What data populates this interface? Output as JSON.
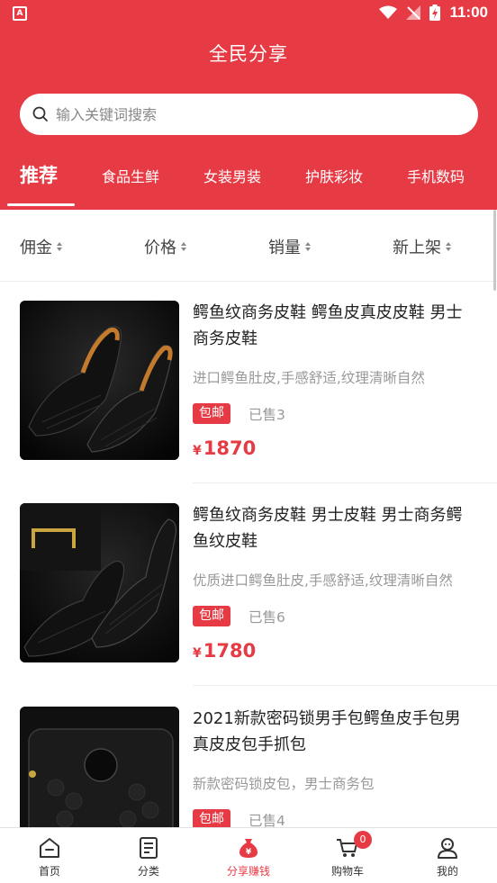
{
  "status_bar": {
    "app_icon_letter": "A",
    "time": "11:00"
  },
  "header": {
    "title": "全民分享"
  },
  "search": {
    "placeholder": "输入关键词搜索"
  },
  "tabs": [
    {
      "label": "推荐",
      "active": true
    },
    {
      "label": "食品生鲜"
    },
    {
      "label": "女装男装"
    },
    {
      "label": "护肤彩妆"
    },
    {
      "label": "手机数码"
    }
  ],
  "sort": [
    {
      "label": "佣金"
    },
    {
      "label": "价格"
    },
    {
      "label": "销量"
    },
    {
      "label": "新上架"
    }
  ],
  "products": [
    {
      "title": "鳄鱼纹商务皮鞋 鳄鱼皮真皮皮鞋 男士商务皮鞋",
      "desc": "进口鳄鱼肚皮,手感舒适,纹理清晰自然",
      "badge": "包邮",
      "sold": "已售3",
      "currency": "¥",
      "price": "1870"
    },
    {
      "title": "鳄鱼纹商务皮鞋 男士皮鞋 男士商务鳄鱼纹皮鞋",
      "desc": "优质进口鳄鱼肚皮,手感舒适,纹理清晰自然",
      "badge": "包邮",
      "sold": "已售6",
      "currency": "¥",
      "price": "1780"
    },
    {
      "title": "2021新款密码锁男手包鳄鱼皮手包男真皮皮包手抓包",
      "desc": "新款密码锁皮包，男士商务包",
      "badge": "包邮",
      "sold": "已售4",
      "currency": "¥",
      "price": ""
    }
  ],
  "bottom_nav": [
    {
      "label": "首页",
      "icon": "home-icon"
    },
    {
      "label": "分类",
      "icon": "category-icon"
    },
    {
      "label": "分享赚钱",
      "icon": "money-bag-icon",
      "active": true
    },
    {
      "label": "购物车",
      "icon": "cart-icon",
      "badge": "0"
    },
    {
      "label": "我的",
      "icon": "profile-icon"
    }
  ],
  "colors": {
    "accent": "#e63b45",
    "muted_text": "#999999"
  }
}
